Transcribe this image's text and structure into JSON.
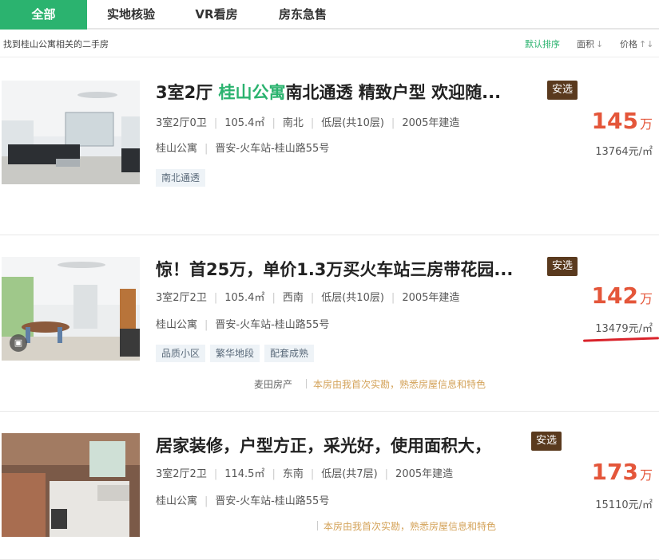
{
  "tabs": [
    {
      "label": "全部"
    },
    {
      "label": "实地核验"
    },
    {
      "label": "VR看房"
    },
    {
      "label": "房东急售"
    }
  ],
  "subbar": {
    "found_text": "找到桂山公寓相关的二手房",
    "sort_default": "默认排序",
    "sort_area": "面积",
    "sort_price": "价格",
    "area_arrow": "↓",
    "price_arrow": "↑↓"
  },
  "listings": [
    {
      "title_a": "3室2厅 ",
      "title_hl": "桂山公寓",
      "title_b": "南北通透 精致户型 欢迎随...",
      "badge": "安选",
      "layout": "3室2厅0卫",
      "area": "105.4㎡",
      "direction": "南北",
      "floor": "低层(共10层)",
      "year": "2005年建造",
      "community": "桂山公寓",
      "address": "晋安-火车站-桂山路55号",
      "tags": [
        "南北通透"
      ],
      "agent": "",
      "agent_note": "",
      "price": "145",
      "price_unit": "万",
      "unit_price": "13764元/㎡"
    },
    {
      "title_a": "惊！首25万，单价1.3万买火车站三房带花园...",
      "title_hl": "",
      "title_b": "",
      "badge": "安选",
      "layout": "3室2厅2卫",
      "area": "105.4㎡",
      "direction": "西南",
      "floor": "低层(共10层)",
      "year": "2005年建造",
      "community": "桂山公寓",
      "address": "晋安-火车站-桂山路55号",
      "tags": [
        "品质小区",
        "繁华地段",
        "配套成熟"
      ],
      "agent": "麦田房产",
      "agent_note": "本房由我首次实勘，熟悉房屋信息和特色",
      "price": "142",
      "price_unit": "万",
      "unit_price": "13479元/㎡"
    },
    {
      "title_a": "居家装修，户型方正，采光好，使用面积大，",
      "title_hl": "",
      "title_b": "",
      "badge": "安选",
      "layout": "3室2厅2卫",
      "area": "114.5㎡",
      "direction": "东南",
      "floor": "低层(共7层)",
      "year": "2005年建造",
      "community": "桂山公寓",
      "address": "晋安-火车站-桂山路55号",
      "tags": [],
      "agent": "",
      "agent_note": "本房由我首次实勘，熟悉房屋信息和特色",
      "price": "173",
      "price_unit": "万",
      "unit_price": "15110元/㎡"
    }
  ],
  "colors": {
    "accent_green": "#2bb36f",
    "price_red": "#e4563a",
    "badge_brown": "#5a3a1e",
    "annotation_red": "#d9232b"
  }
}
